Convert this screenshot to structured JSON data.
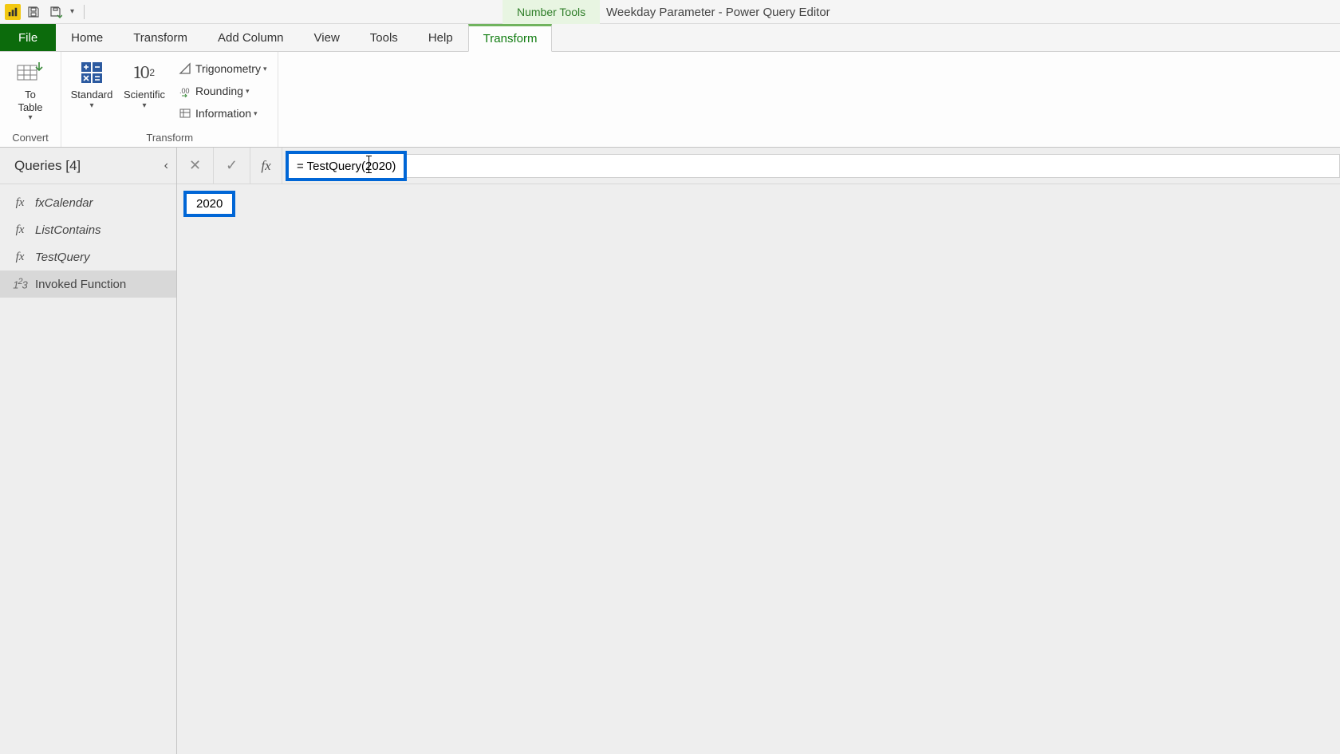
{
  "titlebar": {
    "context_tab": "Number Tools",
    "app_title": "Weekday Parameter - Power Query Editor"
  },
  "tabs": {
    "file": "File",
    "home": "Home",
    "transform": "Transform",
    "add_column": "Add Column",
    "view": "View",
    "tools": "Tools",
    "help": "Help",
    "context_transform": "Transform"
  },
  "ribbon": {
    "convert": {
      "to_table": "To\nTable",
      "group_label": "Convert"
    },
    "transform": {
      "standard": "Standard",
      "scientific": "Scientific",
      "trigonometry": "Trigonometry",
      "rounding": "Rounding",
      "information": "Information",
      "group_label": "Transform"
    }
  },
  "queries": {
    "title": "Queries [4]",
    "items": [
      {
        "name": "fxCalendar",
        "type": "fn"
      },
      {
        "name": "ListContains",
        "type": "fn"
      },
      {
        "name": "TestQuery",
        "type": "fn"
      },
      {
        "name": "Invoked Function",
        "type": "num",
        "selected": true
      }
    ]
  },
  "formula_bar": {
    "value": "= TestQuery(2020)"
  },
  "result": {
    "value": "2020"
  }
}
